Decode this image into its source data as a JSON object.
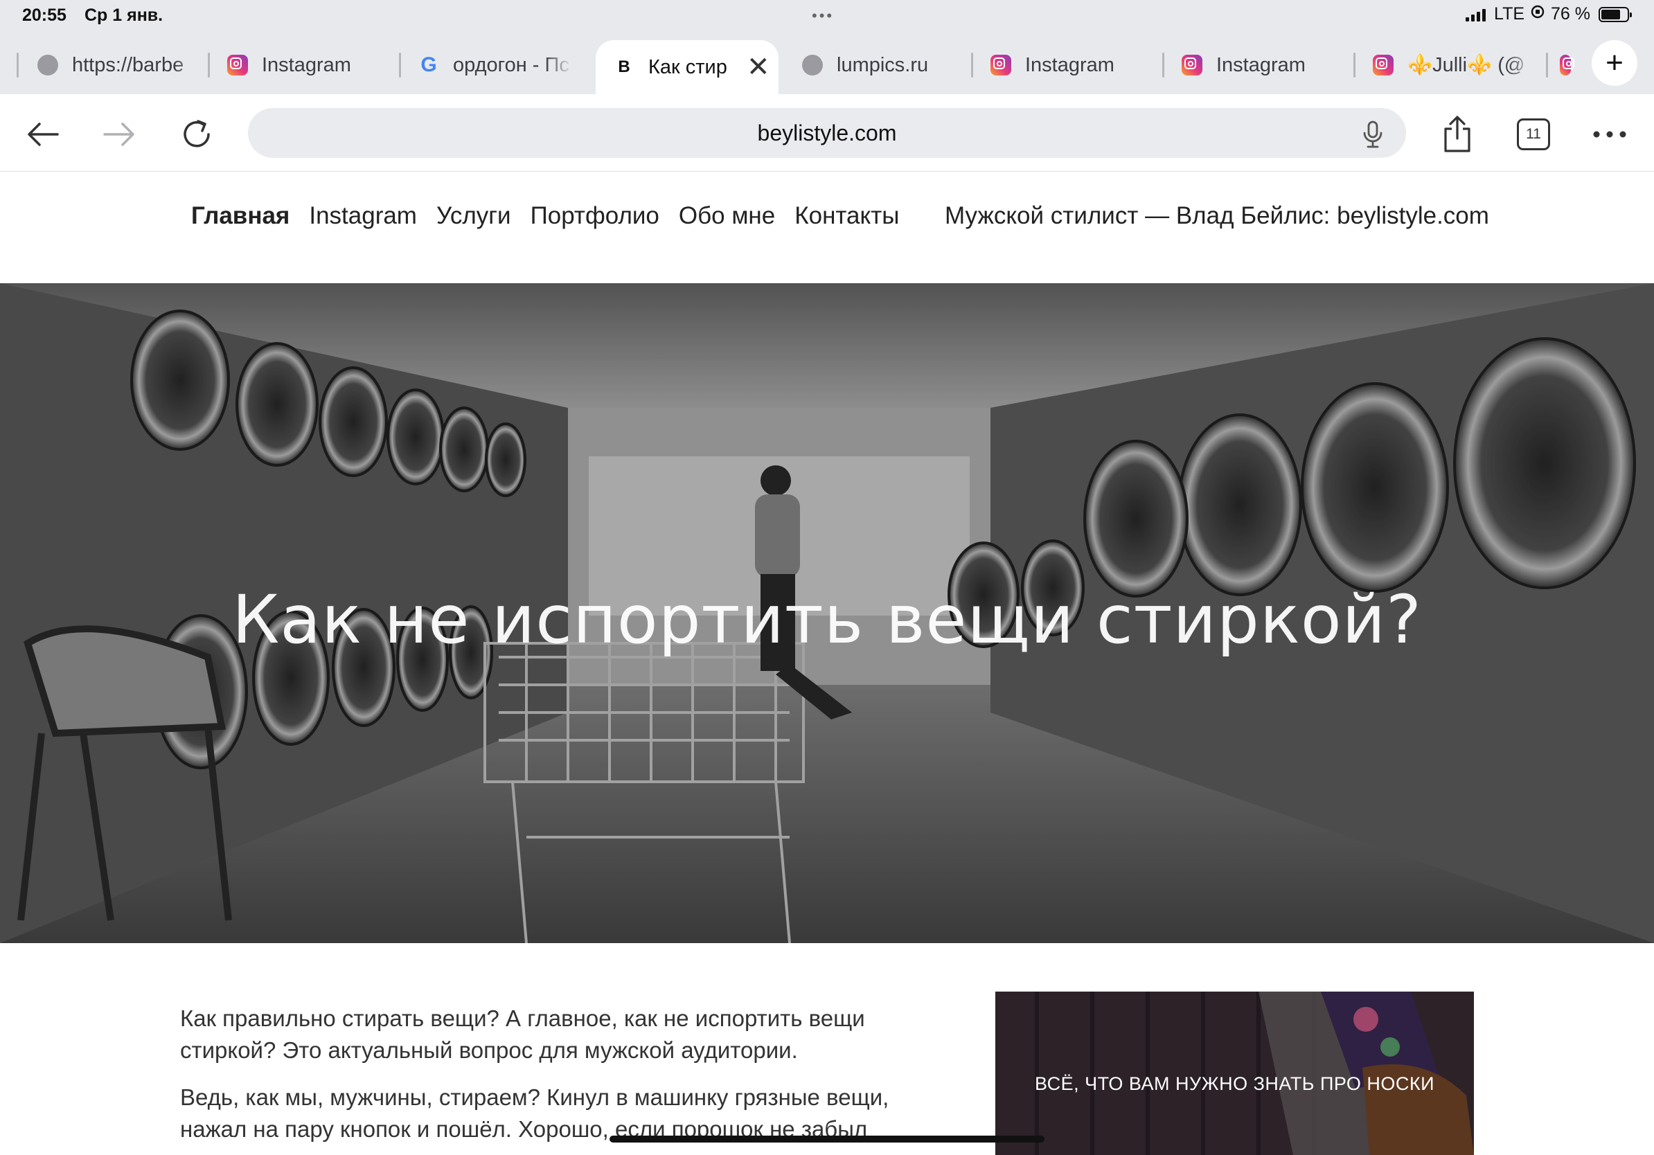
{
  "status_bar": {
    "time": "20:55",
    "date": "Ср 1 янв.",
    "carrier": "LTE",
    "battery": "76 %",
    "battery_level": 0.76
  },
  "tabs": [
    {
      "title": "https://barbe",
      "icon": "globe-icon",
      "active": false
    },
    {
      "title": "Instagram",
      "icon": "instagram-icon",
      "active": false
    },
    {
      "title": "ордогон - Пс",
      "icon": "google-icon",
      "active": false
    },
    {
      "title": "Как стир",
      "icon": "b-icon",
      "icon_text": "B",
      "active": true
    },
    {
      "title": "lumpics.ru",
      "icon": "globe-icon",
      "active": false
    },
    {
      "title": "Instagram",
      "icon": "instagram-icon",
      "active": false
    },
    {
      "title": "Instagram",
      "icon": "instagram-icon",
      "active": false
    },
    {
      "title": "⚜️Julli⚜️ (@",
      "icon": "instagram-icon",
      "active": false
    }
  ],
  "address_bar": {
    "url": "beylistyle.com",
    "tab_count": "11"
  },
  "site_nav": {
    "items": [
      "Главная",
      "Instagram",
      "Услуги",
      "Портфолио",
      "Обо мне",
      "Контакты"
    ],
    "brand": "Мужской стилист — Влад Бейлис: beylistyle.com"
  },
  "hero": {
    "title": "Как не испортить вещи стиркой?"
  },
  "article": {
    "paragraph_1": "Как правильно стирать вещи? А главное, как не испортить вещи стиркой? Это актуальный вопрос для мужской аудитории.",
    "paragraph_2": "Ведь, как мы, мужчины, стираем? Кинул в машинку грязные вещи, нажал на пару кнопок и пошёл. Хорошо, если порошок не забыл"
  },
  "side_card": {
    "title": "ВСЁ, ЧТО ВАМ НУЖНО ЗНАТЬ ПРО НОСКИ"
  }
}
